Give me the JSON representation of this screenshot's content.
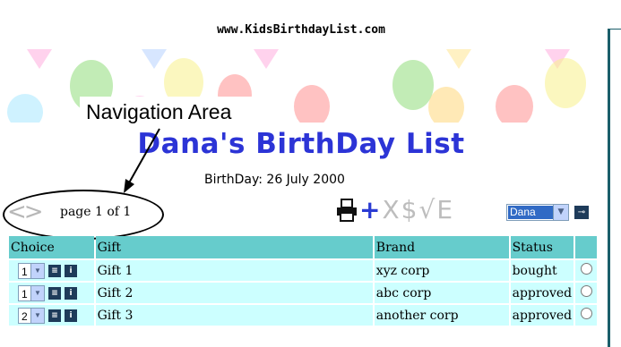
{
  "site": {
    "url": "www.KidsBirthdayList.com"
  },
  "annotation": {
    "label": "Navigation Area"
  },
  "page": {
    "title": "Dana's BirthDay List",
    "birthday_line": "BirthDay: 26 July 2000"
  },
  "navigation": {
    "arrows": "<>",
    "page_info": "page 1 of 1"
  },
  "toolbar": {
    "icons": [
      "printer-icon",
      "add-icon",
      "delete-icon",
      "price-icon",
      "approve-icon",
      "edit-icon"
    ],
    "add": "+",
    "delete": "X",
    "price": "$",
    "approve": "√",
    "edit": "E"
  },
  "user_select": {
    "value": "Dana"
  },
  "table": {
    "headers": [
      "Choice",
      "Gift",
      "Brand",
      "Status"
    ],
    "rows": [
      {
        "choice": "1",
        "gift": "Gift 1",
        "brand": "xyz corp",
        "status": "bought"
      },
      {
        "choice": "1",
        "gift": "Gift 2",
        "brand": "abc corp",
        "status": "approved"
      },
      {
        "choice": "2",
        "gift": "Gift 3",
        "brand": "another corp",
        "status": "approved"
      }
    ]
  },
  "colors": {
    "title_blue": "#2c34d6",
    "header_teal": "#66cccc",
    "row_cyan": "#ccffff",
    "icon_navy": "#1e3b5a"
  }
}
